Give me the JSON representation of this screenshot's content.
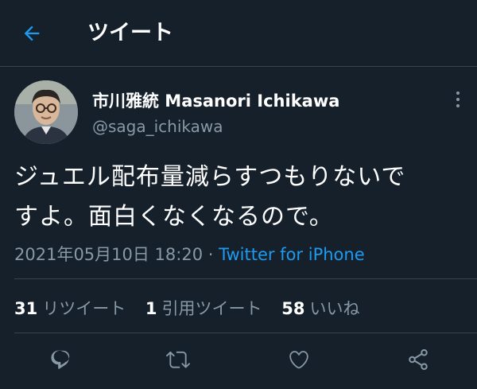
{
  "header": {
    "title": "ツイート",
    "back_icon": "back-arrow-icon",
    "accent_color": "#1d9bf0"
  },
  "tweet": {
    "display_name": "市川雅統 Masanori  Ichikawa",
    "handle": "@saga_ichikawa",
    "text_line1": "ジュエル配布量減らすつもりないで",
    "text_line2": "すよ。面白くなくなるので。",
    "timestamp": "2021年05月10日 18:20",
    "separator": " · ",
    "source": "Twitter for iPhone"
  },
  "stats": {
    "retweets_count": "31",
    "retweets_label": "リツイート",
    "quotes_count": "1",
    "quotes_label": "引用ツイート",
    "likes_count": "58",
    "likes_label": "いいね"
  },
  "actions": [
    "reply-icon",
    "retweet-icon",
    "like-icon",
    "share-icon"
  ],
  "colors": {
    "background": "#15202b",
    "secondary_text": "#8899a6",
    "divider": "#38444d"
  }
}
